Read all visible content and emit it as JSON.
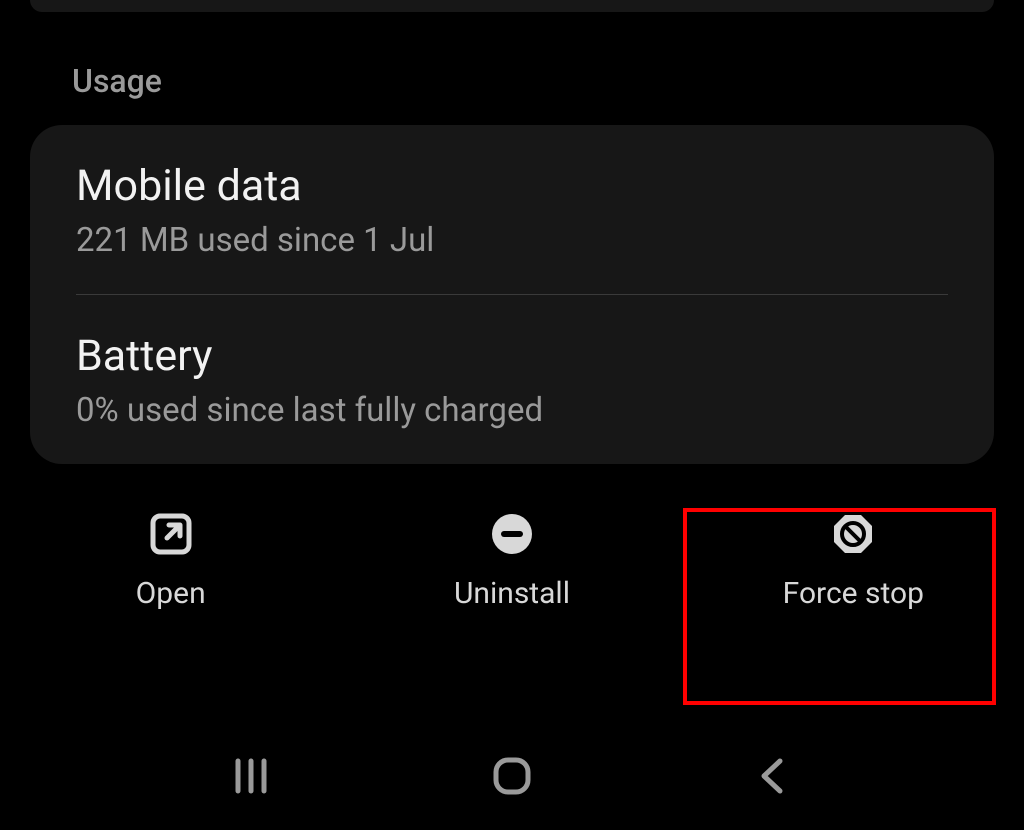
{
  "section": {
    "title": "Usage"
  },
  "rows": {
    "mobile_data": {
      "title": "Mobile data",
      "subtitle": "221 MB used since 1 Jul"
    },
    "battery": {
      "title": "Battery",
      "subtitle": "0% used since last fully charged"
    }
  },
  "actions": {
    "open": "Open",
    "uninstall": "Uninstall",
    "force_stop": "Force stop"
  }
}
